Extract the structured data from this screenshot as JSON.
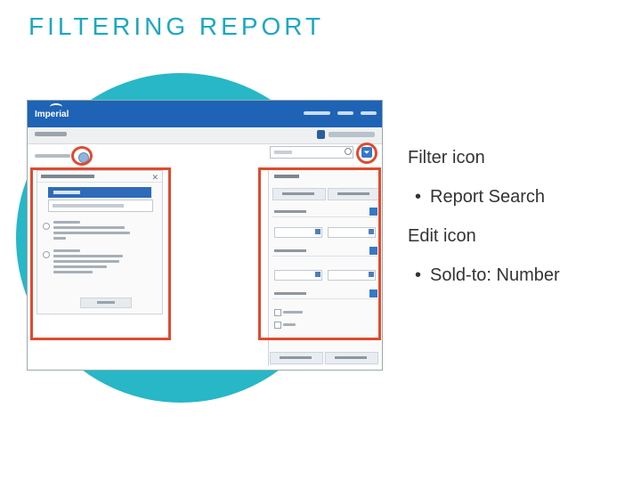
{
  "slide": {
    "title": "FILTERING REPORT"
  },
  "notes": [
    {
      "level": 1,
      "text": "Filter icon"
    },
    {
      "level": 2,
      "text": "Report Search"
    },
    {
      "level": 1,
      "text": "Edit icon"
    },
    {
      "level": 2,
      "text": "Sold-to: Number"
    }
  ],
  "screenshot": {
    "logo": "Imperial"
  },
  "colors": {
    "title": "#1aa9c0",
    "circle": "#27b7c7",
    "highlight": "#e04b2c",
    "app_header": "#1e63b5"
  },
  "icons": {
    "filter": "filter-icon",
    "edit": "edit-icon",
    "search": "search-icon",
    "bullet": "•"
  }
}
